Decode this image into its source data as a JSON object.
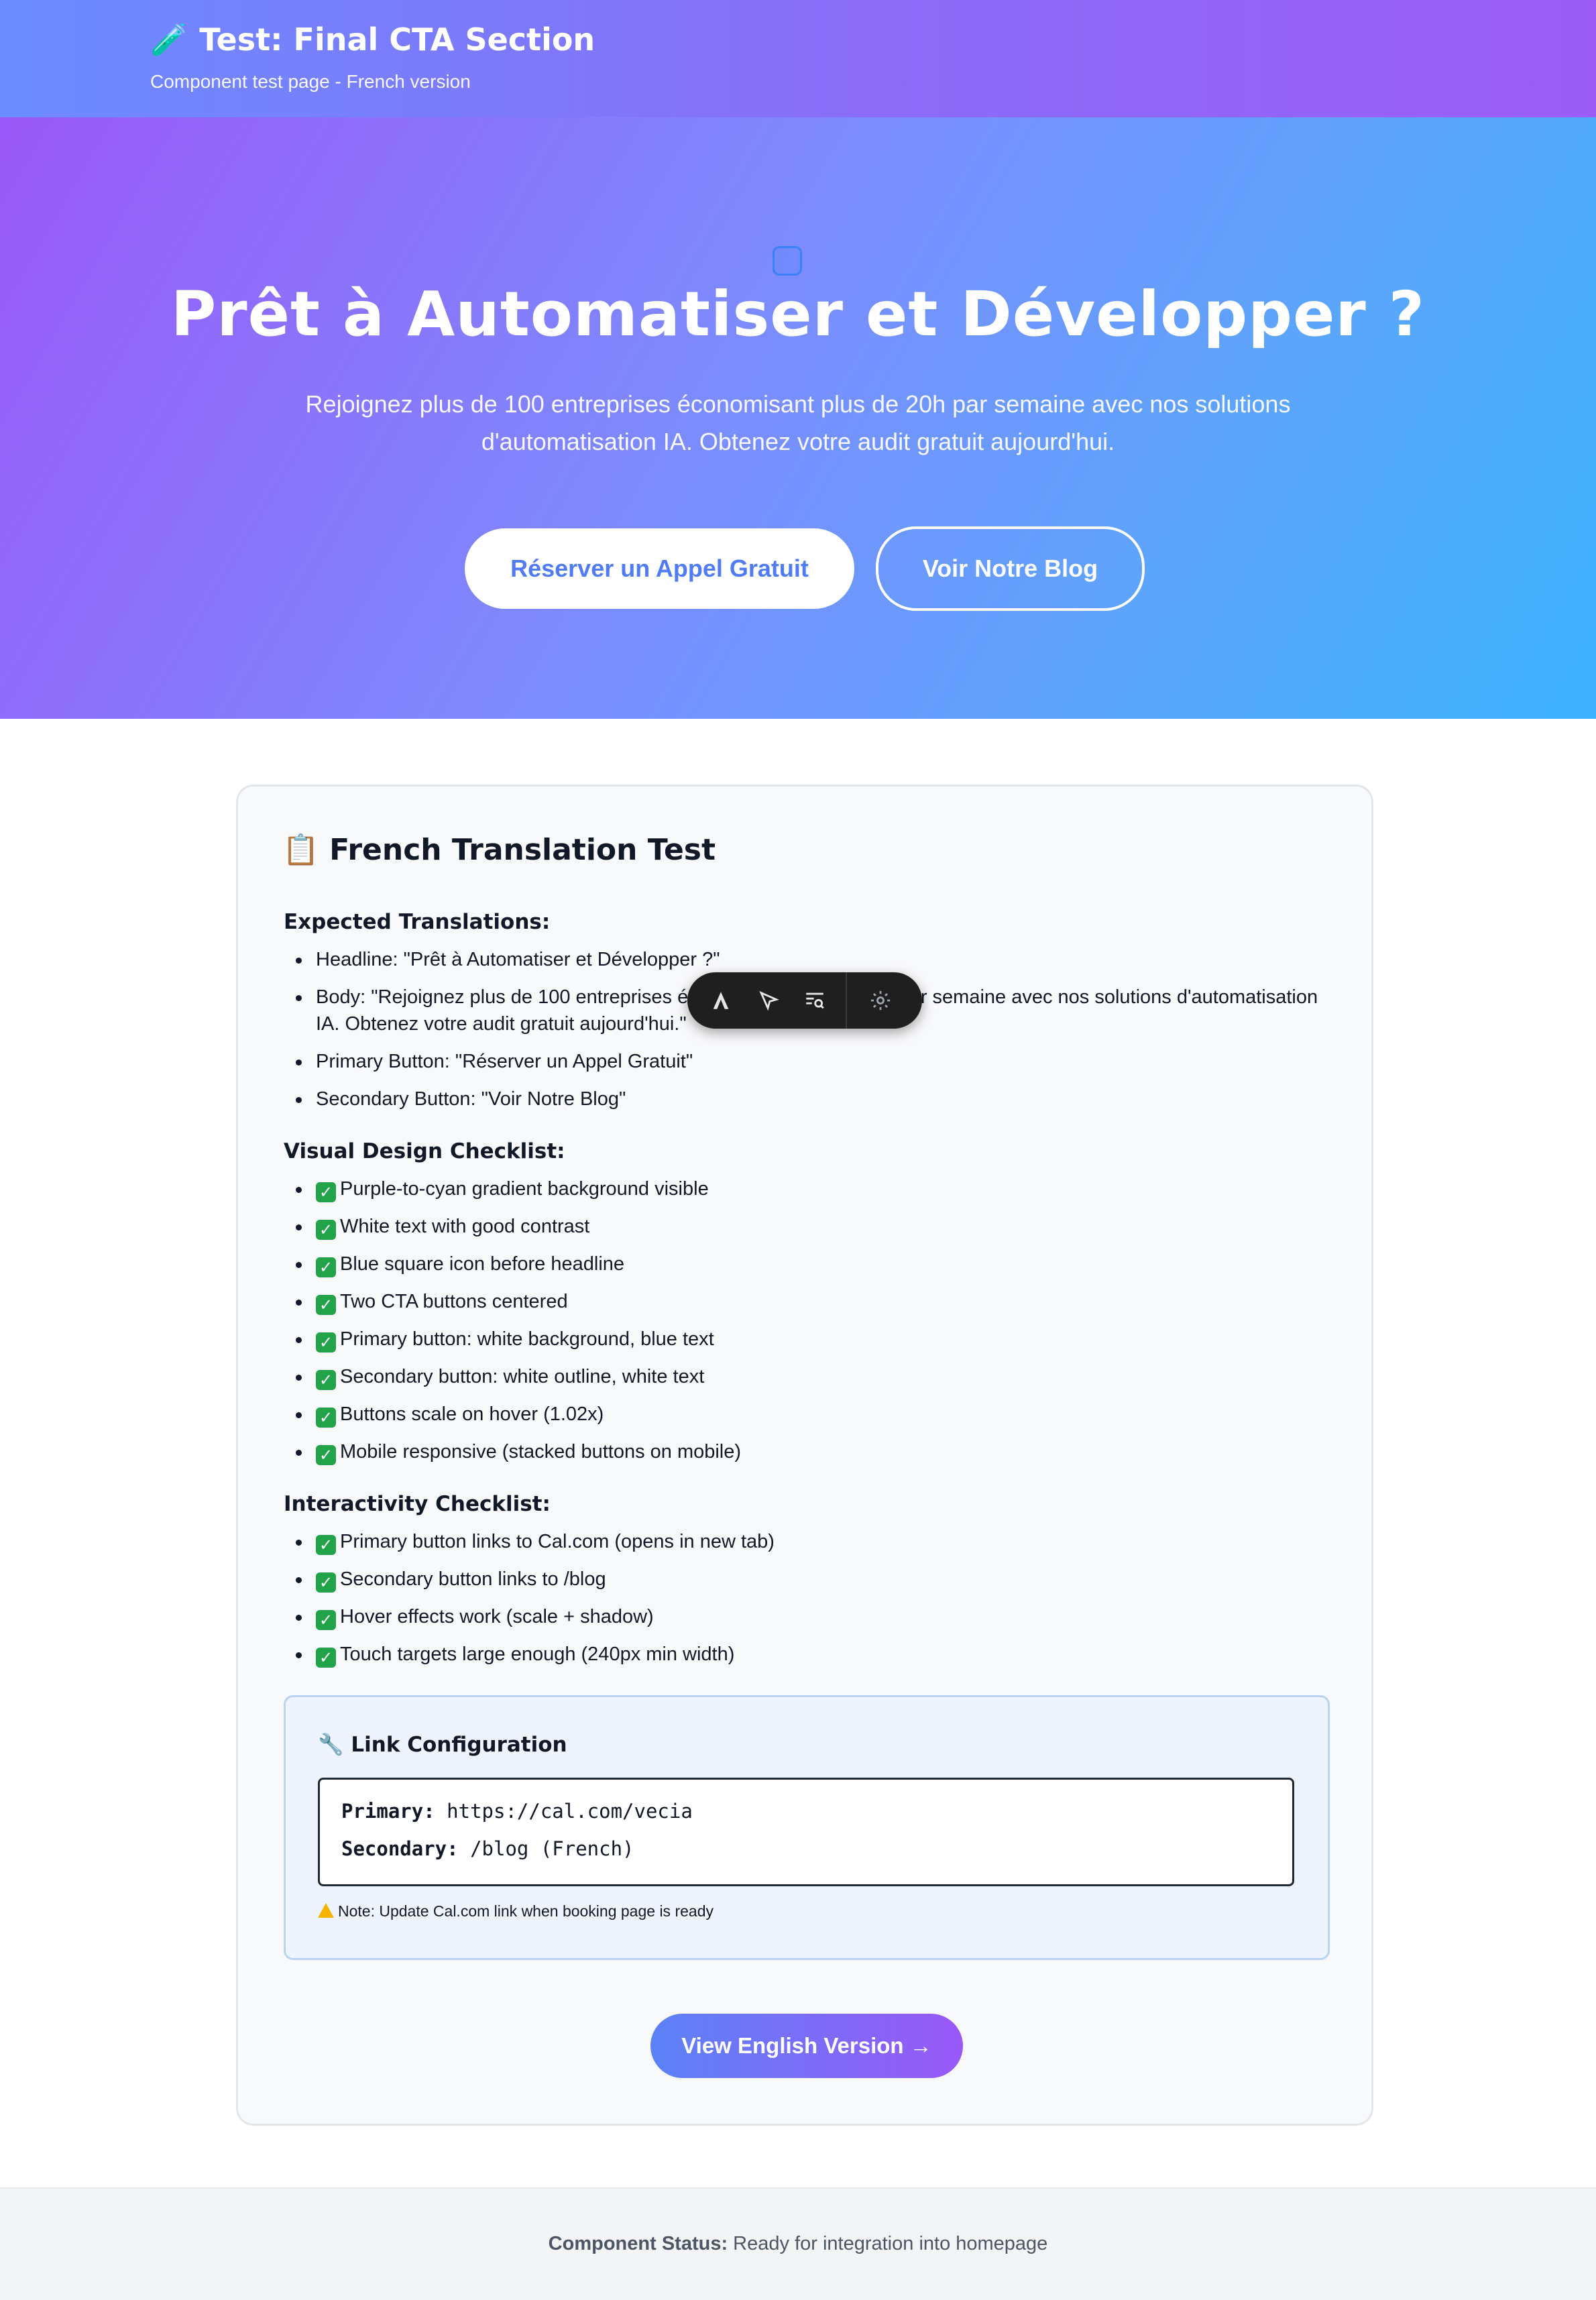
{
  "header": {
    "title": "🧪 Test: Final CTA Section",
    "subtitle": "Component test page - French version"
  },
  "hero": {
    "headline": "Prêt à Automatiser et Développer ?",
    "body": "Rejoignez plus de 100 entreprises économisant plus de 20h par semaine avec nos solutions d'automatisation IA. Obtenez votre audit gratuit aujourd'hui.",
    "primary_button": "Réserver un Appel Gratuit",
    "secondary_button": "Voir Notre Blog",
    "icon": "square-icon"
  },
  "card": {
    "title": "📋 French Translation Test",
    "expected_heading": "Expected Translations:",
    "expected": [
      "Headline: \"Prêt à Automatiser et Développer ?\"",
      "Body: \"Rejoignez plus de 100 entreprises économisant plus de 20h par semaine avec nos solutions d'automatisation IA. Obtenez votre audit gratuit aujourd'hui.\"",
      "Primary Button: \"Réserver un Appel Gratuit\"",
      "Secondary Button: \"Voir Notre Blog\""
    ],
    "visual_heading": "Visual Design Checklist:",
    "visual": [
      "Purple-to-cyan gradient background visible",
      "White text with good contrast",
      "Blue square icon before headline",
      "Two CTA buttons centered",
      "Primary button: white background, blue text",
      "Secondary button: white outline, white text",
      "Buttons scale on hover (1.02x)",
      "Mobile responsive (stacked buttons on mobile)"
    ],
    "interactivity_heading": "Interactivity Checklist:",
    "interactivity": [
      "Primary button links to Cal.com (opens in new tab)",
      "Secondary button links to /blog",
      "Hover effects work (scale + shadow)",
      "Touch targets large enough (240px min width)"
    ],
    "link_config": {
      "title": "🔧 Link Configuration",
      "primary_label": "Primary:",
      "primary_value": "https://cal.com/vecia",
      "secondary_label": "Secondary:",
      "secondary_value": "/blog (French)",
      "note": "Note: Update Cal.com link when booking page is ready"
    },
    "english_button": "View English Version →"
  },
  "toolbar": {
    "icons": [
      "text-style-icon",
      "cursor-select-icon",
      "inspect-icon",
      "settings-gear-icon"
    ]
  },
  "footer": {
    "status_label": "Component Status:",
    "status_value": "Ready for integration into homepage"
  },
  "colors": {
    "hero_gradient_start": "#9a58f8",
    "hero_gradient_end": "#3db3fd",
    "primary_text": "#4f7cf5",
    "check_green": "#22a34a"
  }
}
